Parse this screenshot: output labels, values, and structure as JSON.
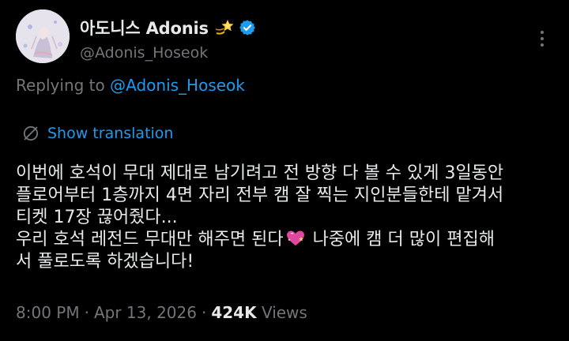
{
  "tweet": {
    "display_name": "아도니스 Adonis",
    "handle": "@Adonis_Hoseok",
    "replying_prefix": "Replying to",
    "replying_to": "@Adonis_Hoseok",
    "show_translation": "Show translation",
    "body_lines": [
      "이번에 호석이 무대 제대로 남기려고 전 방향 다 볼 수 있게 3일동안",
      "플로어부터 1층까지 4면 자리 전부 캠 잘 찍는 지인분들한테 맡겨서",
      "티켓 17장 끊어줬다...",
      "우리 호석 레전드 무대만 해주면 된다",
      "나중에 캠 더 많이 편집해",
      "서 풀로도록 하겠습니다!"
    ],
    "time": "8:00 PM",
    "date": "Apr 13, 2026",
    "dot": "·",
    "views_count": "424K",
    "views_label": "Views"
  },
  "icons": {
    "name_emoji": "dizzy-star-emoji",
    "verified": "verified-badge-icon",
    "more": "more-options-icon",
    "translate": "translate-icon",
    "heart": "sparkling-heart-emoji"
  },
  "colors": {
    "background": "#000000",
    "text": "#e7e9ea",
    "secondary": "#71767b",
    "accent": "#1d9bf0"
  }
}
